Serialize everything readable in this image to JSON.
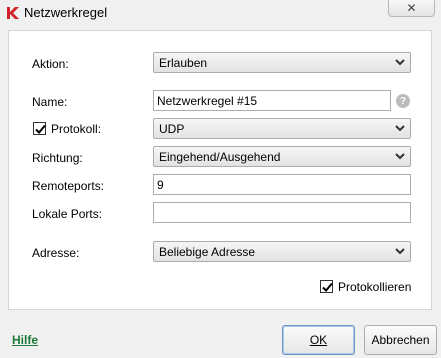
{
  "window": {
    "title": "Netzwerkregel",
    "close_glyph": "✕"
  },
  "form": {
    "aktion": {
      "label": "Aktion:",
      "value": "Erlauben"
    },
    "name": {
      "label": "Name:",
      "value": "Netzwerkregel #15"
    },
    "protokoll": {
      "label": "Protokoll:",
      "value": "UDP",
      "checked": true
    },
    "richtung": {
      "label": "Richtung:",
      "value": "Eingehend/Ausgehend"
    },
    "remoteports": {
      "label": "Remoteports:",
      "value": "9"
    },
    "lokale_ports": {
      "label": "Lokale Ports:",
      "value": ""
    },
    "adresse": {
      "label": "Adresse:",
      "value": "Beliebige Adresse"
    },
    "protokollieren": {
      "label": "Protokollieren",
      "checked": true
    }
  },
  "footer": {
    "help_label": "Hilfe",
    "ok_label": "OK",
    "cancel_label": "Abbrechen"
  },
  "colors": {
    "help_link": "#1f7a3a",
    "app_icon": "#d0202a"
  }
}
